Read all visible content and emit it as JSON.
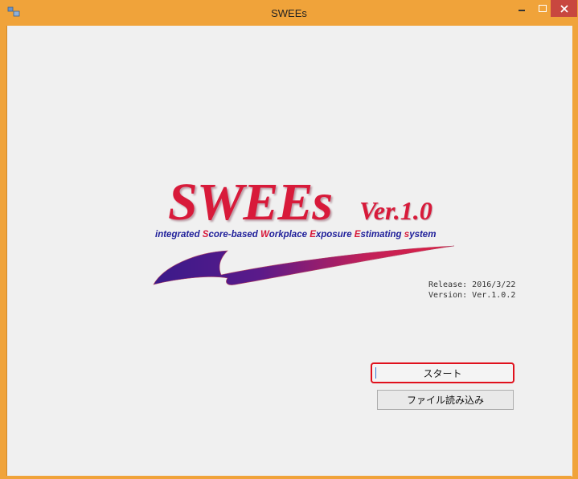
{
  "window": {
    "title": "SWEEs",
    "controls": {
      "minimize": "–",
      "maximize": "□",
      "close": "×"
    }
  },
  "logo": {
    "title": "SWEEs",
    "version_mark": "Ver.1.0",
    "subtitle_parts": [
      {
        "text": "integrated ",
        "highlight": false
      },
      {
        "text": "S",
        "highlight": true
      },
      {
        "text": "core-based ",
        "highlight": false
      },
      {
        "text": "W",
        "highlight": true
      },
      {
        "text": "orkplace ",
        "highlight": false
      },
      {
        "text": "E",
        "highlight": true
      },
      {
        "text": "xposure ",
        "highlight": false
      },
      {
        "text": "E",
        "highlight": true
      },
      {
        "text": "stimating ",
        "highlight": false
      },
      {
        "text": "s",
        "highlight": true
      },
      {
        "text": "ystem",
        "highlight": false
      }
    ]
  },
  "release_info": {
    "release": "Release: 2016/3/22",
    "version": "Version: Ver.1.0.2"
  },
  "buttons": {
    "start": "スタート",
    "load_file": "ファイル読み込み"
  },
  "colors": {
    "frame": "#f0a33a",
    "accent_red": "#d81a3a",
    "accent_blue": "#1f1f9a",
    "highlight_border": "#e0101c"
  }
}
